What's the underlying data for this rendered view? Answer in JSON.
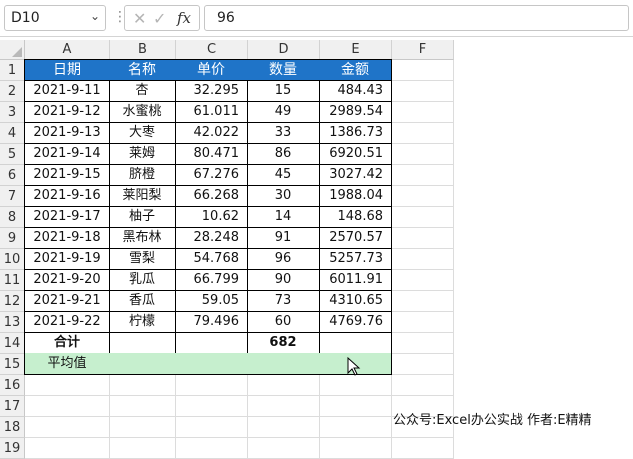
{
  "formula_bar": {
    "name_box": "D10",
    "formula_value": "96",
    "fx_label": "fx"
  },
  "columns": [
    "A",
    "B",
    "C",
    "D",
    "E",
    "F"
  ],
  "rows": [
    "1",
    "2",
    "3",
    "4",
    "5",
    "6",
    "7",
    "8",
    "9",
    "10",
    "11",
    "12",
    "13",
    "14",
    "15",
    "16",
    "17",
    "18",
    "19"
  ],
  "table": {
    "headers": [
      "日期",
      "名称",
      "单价",
      "数量",
      "金额"
    ],
    "rows": [
      [
        "2021-9-11",
        "杏",
        "32.295",
        "15",
        "484.43"
      ],
      [
        "2021-9-12",
        "水蜜桃",
        "61.011",
        "49",
        "2989.54"
      ],
      [
        "2021-9-13",
        "大枣",
        "42.022",
        "33",
        "1386.73"
      ],
      [
        "2021-9-14",
        "莱姆",
        "80.471",
        "86",
        "6920.51"
      ],
      [
        "2021-9-15",
        "脐橙",
        "67.276",
        "45",
        "3027.42"
      ],
      [
        "2021-9-16",
        "莱阳梨",
        "66.268",
        "30",
        "1988.04"
      ],
      [
        "2021-9-17",
        "柚子",
        "10.62",
        "14",
        "148.68"
      ],
      [
        "2021-9-18",
        "黑布林",
        "28.248",
        "91",
        "2570.57"
      ],
      [
        "2021-9-19",
        "雪梨",
        "54.768",
        "96",
        "5257.73"
      ],
      [
        "2021-9-20",
        "乳瓜",
        "66.799",
        "90",
        "6011.91"
      ],
      [
        "2021-9-21",
        "香瓜",
        "59.05",
        "73",
        "4310.65"
      ],
      [
        "2021-9-22",
        "柠檬",
        "79.496",
        "60",
        "4769.76"
      ]
    ],
    "total_label": "合计",
    "total_quantity": "682",
    "average_label": "平均值"
  },
  "watermark": "公众号:Excel办公实战  作者:E精精",
  "colors": {
    "header_fill": "#1f74c8",
    "average_fill": "#c6efce"
  }
}
